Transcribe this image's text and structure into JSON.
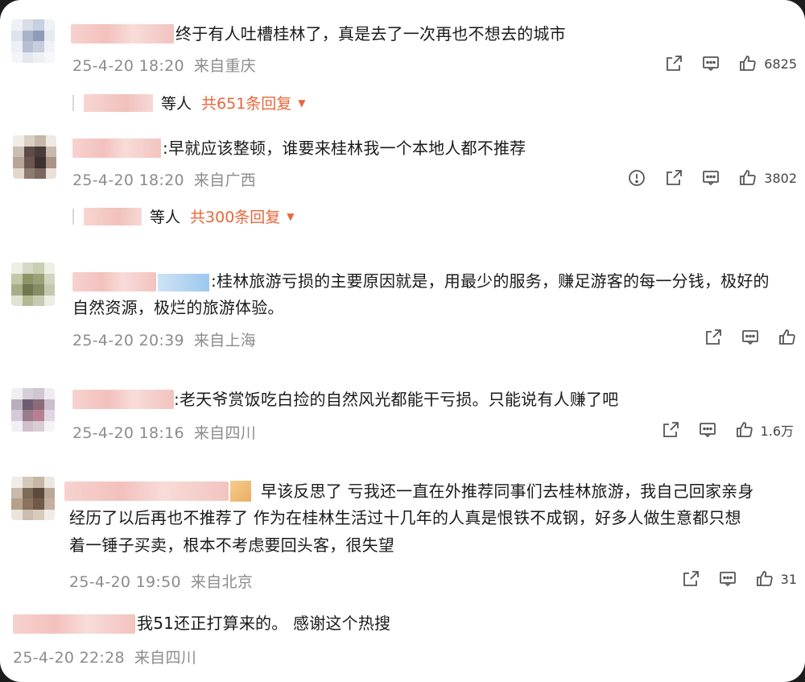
{
  "comments": [
    {
      "text_lines": [
        "终于有人吐槽桂林了，真是去了一次再也不想去的城市"
      ],
      "time": "25-4-20 18:20",
      "location": "来自重庆",
      "replies": {
        "suffix": "等人",
        "count": "共651条回复"
      },
      "likes": "6825"
    },
    {
      "text_lines": [
        ":早就应该整顿，谁要来桂林我一个本地人都不推荐"
      ],
      "time": "25-4-20 18:20",
      "location": "来自广西",
      "replies": {
        "suffix": "等人",
        "count": "共300条回复"
      },
      "likes": "3802"
    },
    {
      "text_lines": [
        ":桂林旅游亏损的主要原因就是，用最少的服务，赚足游客的每一分钱，极好的",
        "自然资源，极烂的旅游体验。"
      ],
      "time": "25-4-20 20:39",
      "location": "来自上海",
      "likes": ""
    },
    {
      "text_lines": [
        ":老天爷赏饭吃白捡的自然风光都能干亏损。只能说有人赚了吧"
      ],
      "time": "25-4-20 18:16",
      "location": "来自四川",
      "likes": "1.6万"
    },
    {
      "text_lines": [
        "早该反思了  亏我还一直在外推荐同事们去桂林旅游，我自己回家亲身",
        "经历了以后再也不推荐了   作为在桂林生活过十几年的人真是恨铁不成钢，好多人做生意都只想",
        "着一锤子买卖，根本不考虑要回头客，很失望"
      ],
      "time": "25-4-20 19:50",
      "location": "来自北京",
      "likes": "31"
    },
    {
      "text_lines": [
        "我51还正打算来的。 感谢这个热搜"
      ],
      "time": "25-4-20 22:28",
      "location": "来自四川"
    }
  ],
  "icons": {
    "share": "share-icon",
    "comment": "comment-icon",
    "like": "thumbs-up-icon",
    "report": "report-icon",
    "more_replies": "triangle-down-icon"
  },
  "colors": {
    "accent": "#e8663a",
    "meta": "#8c8c8c",
    "text": "#1a1a1a"
  }
}
